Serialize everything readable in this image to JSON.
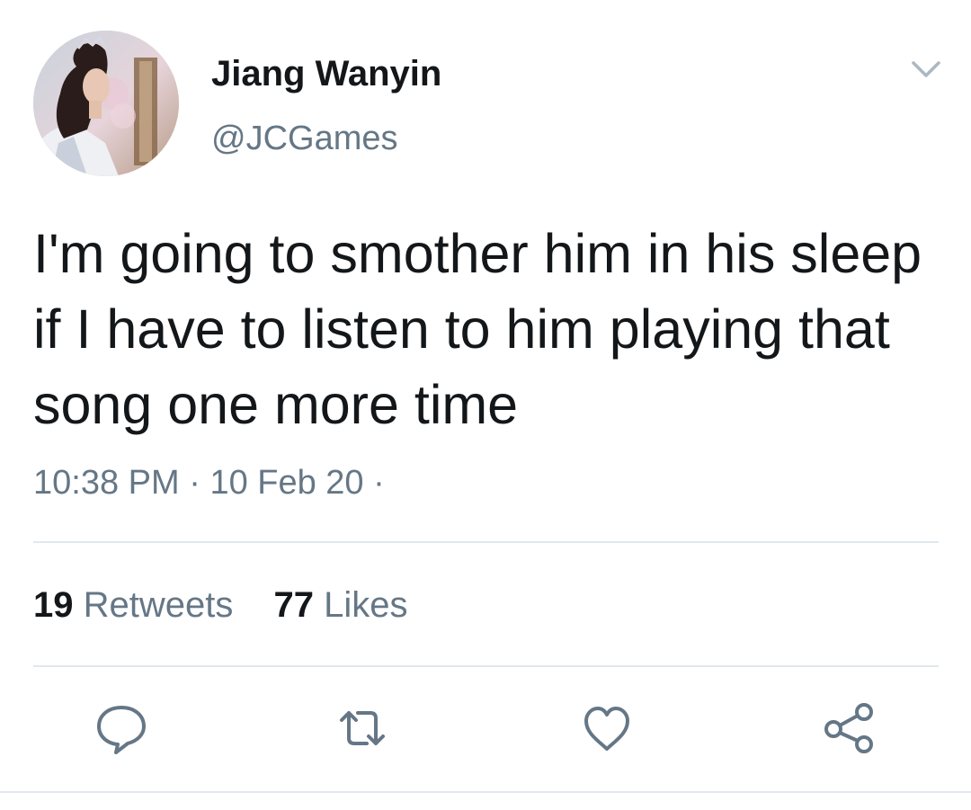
{
  "tweet": {
    "author_name": "Jiang Wanyin",
    "author_handle": "@JCGames",
    "text": "I'm going to smother him in his sleep if I have to listen to him playing that song one more time",
    "time": "10:38 PM",
    "separator": "·",
    "date": "10 Feb 20",
    "trailing_separator": "·"
  },
  "stats": {
    "retweets_count": "19",
    "retweets_label": "Retweets",
    "likes_count": "77",
    "likes_label": "Likes"
  },
  "icons": {
    "more": "chevron-down-icon",
    "reply": "reply-icon",
    "retweet": "retweet-icon",
    "like": "heart-icon",
    "share": "share-icon"
  },
  "colors": {
    "text": "#14171a",
    "secondary": "#657786",
    "divider": "#e1e8ed",
    "icon": "#657786"
  }
}
